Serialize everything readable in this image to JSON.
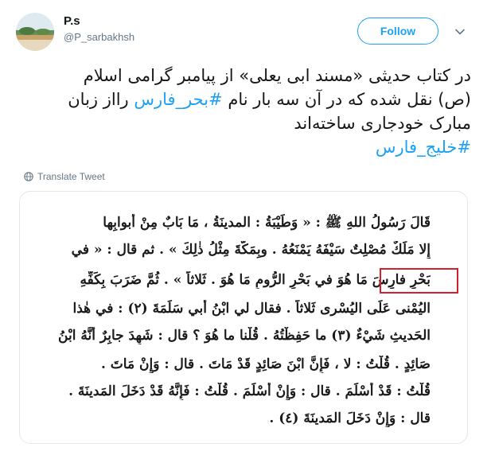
{
  "user": {
    "display_name": "P.s",
    "handle": "@P_sarbakhsh",
    "avatar_icon": "landscape-avatar"
  },
  "actions": {
    "follow_label": "Follow",
    "more_icon": "chevron-down-icon"
  },
  "tweet": {
    "line1": "در کتاب حدیثی «مسند ابی یعلی» از پیامبر گرامی اسلام",
    "line2_before": "(ص) نقل شده که در آن سه بار نام ",
    "line2_hashtag": "#بحر_فارس",
    "line2_after": " رااز زبان",
    "line3": "مبارک خودجاری ساخته‌اند",
    "line4_hashtag": "#خلیج_فارس"
  },
  "translate": {
    "label": "Translate Tweet",
    "icon": "globe-icon"
  },
  "media": {
    "lines": [
      "قَالَ رَسُولُ اللهِ ﷺ : « وَطَيْبَةُ : المدينَةُ ، مَا بَابٌ مِنْ أبوابِها",
      "إِلا مَلَكٌ مُصْلِتٌ سَيْفَهُ يَمْنَعُهُ . وبِمَكَّةَ مِثْلُ ذٰلِكَ » . ثم قال : « في",
      "بَحْرِ فارِسَ مَا هُوَ في بَحْرِ الرُّومِ مَا هُوَ . ثَلاثاً » . ثُمَّ ضَرَبَ بِكَفِّهِ",
      "اليُمْنى عَلَى اليُسْرى ثَلاثاً . فقال لي ابْنُ أبي سَلَمَةَ (٢) : في هٰذا",
      "الحَديثِ شَيْءٌ (٣) ما حَفِظْتُهُ . قُلْنا ما هُوَ ؟ قال : شَهِدَ جابِرٌ أَنَّهُ ابْنُ",
      "صَائِدٍ . قُلْتُ : لا ، فَإِنَّ ابْنَ صَائِدٍ قَدْ مَاتَ . قال : وَإِنْ مَاتَ .",
      "قُلْتُ : قَدْ أَسْلَمَ . قال : وَإِنْ أَسْلَمَ . قُلْتُ : فَإِنَّهُ قَدْ دَخَلَ المَدينَةَ .",
      "قال : وَإِنْ دَخَلَ المَدينَةَ (٤) ."
    ]
  },
  "colors": {
    "accent": "#1da1f2",
    "text": "#14171a",
    "muted": "#657786",
    "highlight": "#d2202f"
  }
}
